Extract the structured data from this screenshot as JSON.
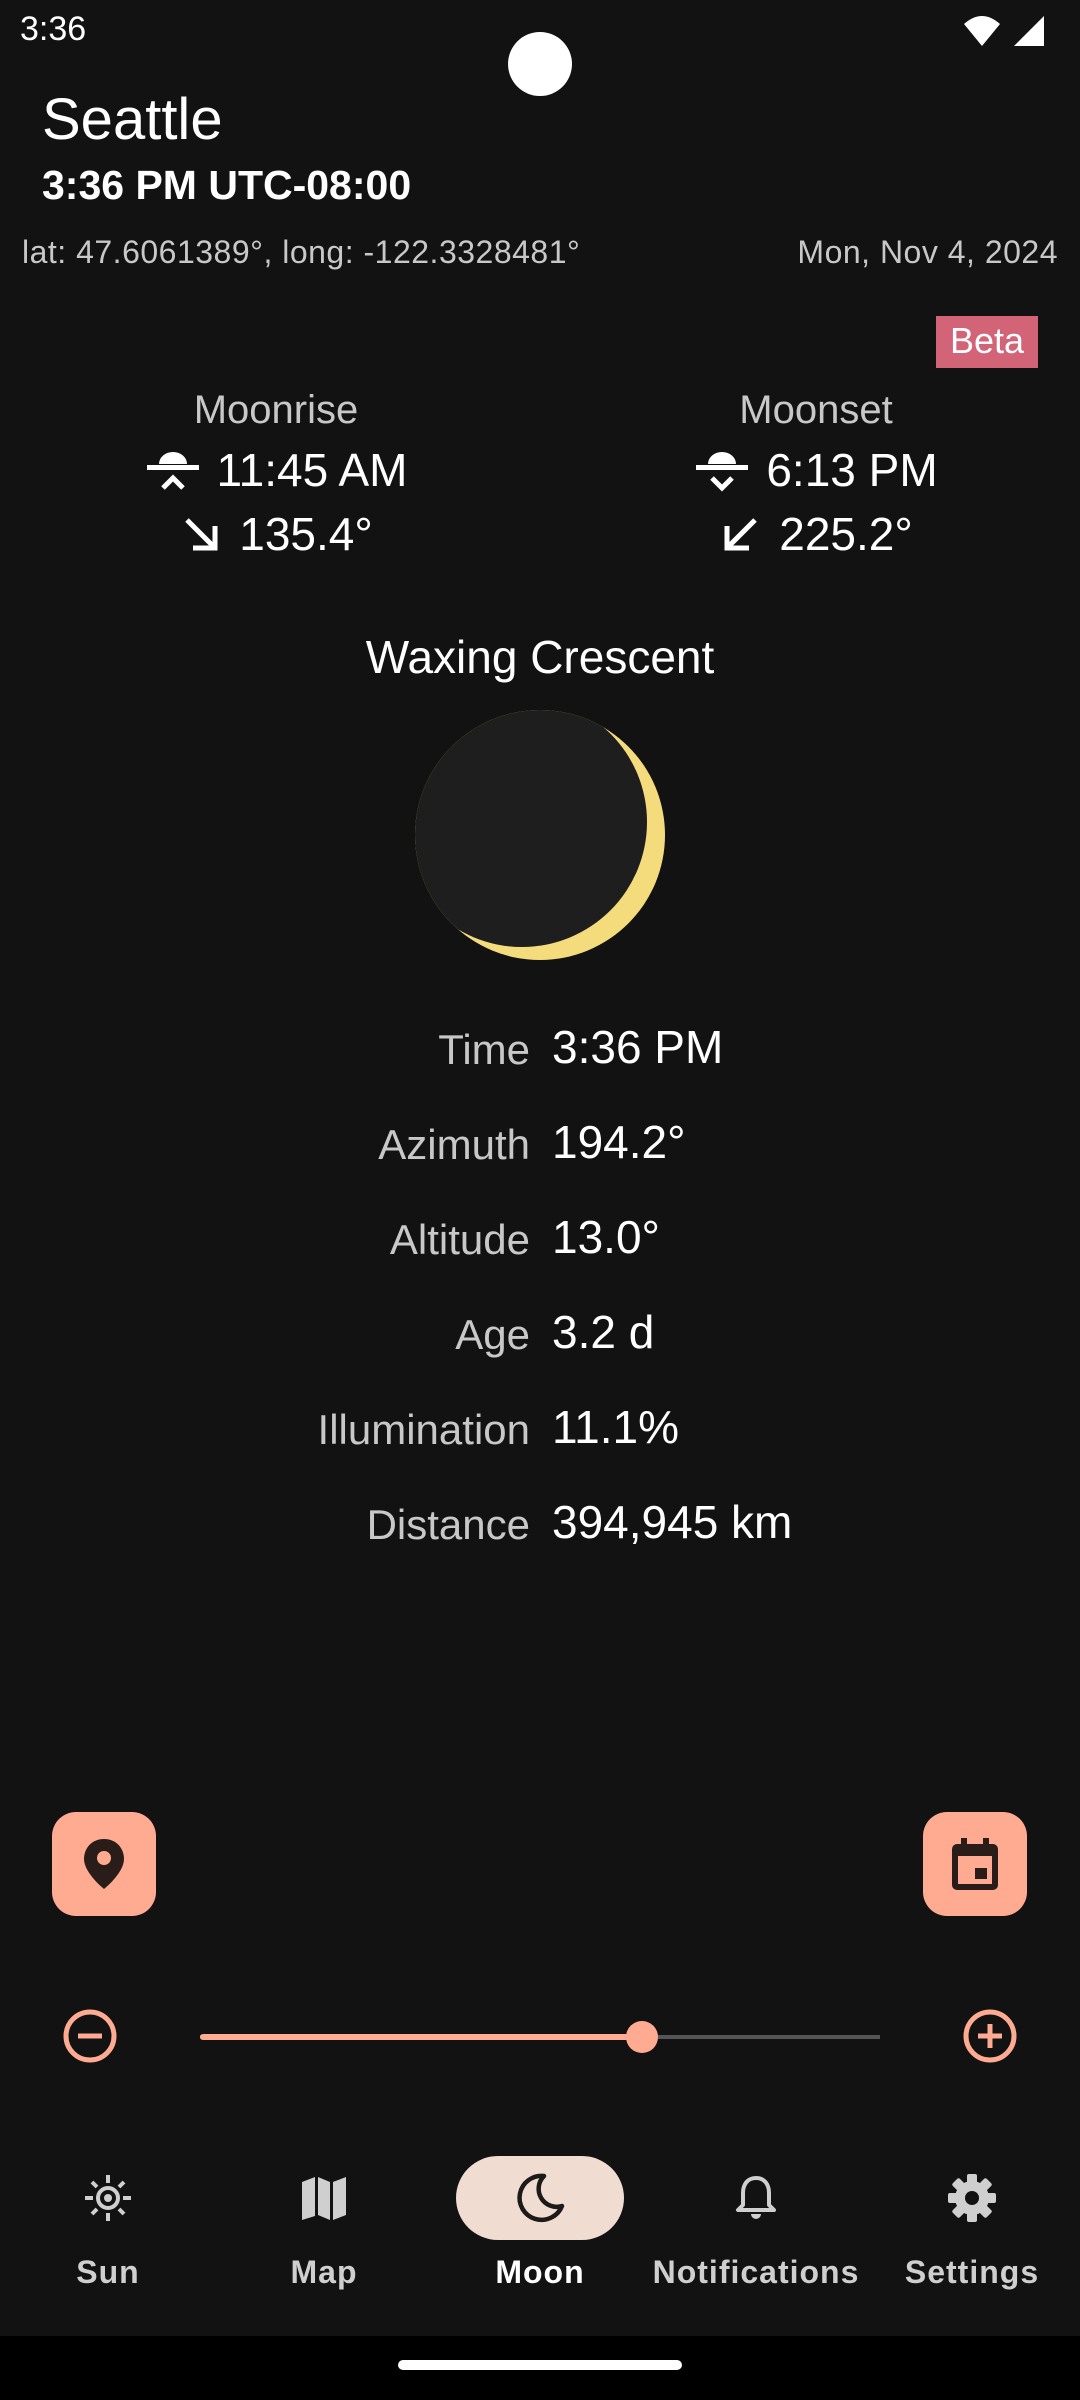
{
  "status_bar": {
    "time": "3:36"
  },
  "location": {
    "city": "Seattle",
    "local_time": "3:36 PM UTC-08:00",
    "coordinates": "lat: 47.6061389°, long: -122.3328481°",
    "date": "Mon, Nov 4, 2024"
  },
  "badge": "Beta",
  "moonrise": {
    "title": "Moonrise",
    "time": "11:45 AM",
    "azimuth": "135.4°"
  },
  "moonset": {
    "title": "Moonset",
    "time": "6:13 PM",
    "azimuth": "225.2°"
  },
  "phase": {
    "name": "Waxing Crescent",
    "illumination_fraction": 0.111
  },
  "details": [
    {
      "label": "Time",
      "value": "3:36 PM"
    },
    {
      "label": "Azimuth",
      "value": "194.2°"
    },
    {
      "label": "Altitude",
      "value": "13.0°"
    },
    {
      "label": "Age",
      "value": "3.2 d"
    },
    {
      "label": "Illumination",
      "value": "11.1%"
    },
    {
      "label": "Distance",
      "value": "394,945 km"
    }
  ],
  "time_slider": {
    "fraction": 0.65
  },
  "nav": [
    {
      "label": "Sun",
      "icon": "sun-icon",
      "active": false
    },
    {
      "label": "Map",
      "icon": "map-icon",
      "active": false
    },
    {
      "label": "Moon",
      "icon": "moon-icon",
      "active": true
    },
    {
      "label": "Notifications",
      "icon": "bell-icon",
      "active": false
    },
    {
      "label": "Settings",
      "icon": "gear-icon",
      "active": false
    }
  ],
  "colors": {
    "background": "#121212",
    "accent": "#ffab91",
    "beta_badge": "#d36478",
    "moon_lit": "#f4dc7c",
    "moon_dark": "#1e1e1e",
    "active_nav_pill": "#f1dcd2"
  }
}
